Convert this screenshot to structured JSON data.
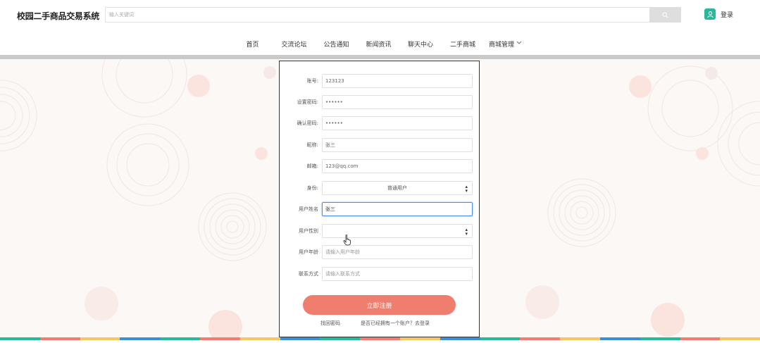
{
  "header": {
    "brand": "校园二手商品交易系统",
    "search_placeholder": "输入关键词",
    "login_label": "登录"
  },
  "nav": {
    "items": [
      {
        "label": "首页",
        "color": "#26b99a"
      },
      {
        "label": "交流论坛",
        "color": "#f07e6e"
      },
      {
        "label": "公告通知",
        "color": "#f5c865"
      },
      {
        "label": "新闻资讯",
        "color": "#3b8ed8"
      },
      {
        "label": "聊天中心",
        "color": "#26b99a"
      },
      {
        "label": "二手商城",
        "color": "#f07e6e"
      },
      {
        "label": "商城管理",
        "color": "#f5c865"
      }
    ]
  },
  "form": {
    "fields": [
      {
        "label": "账号:",
        "value": "123123",
        "placeholder": ""
      },
      {
        "label": "设置密码:",
        "value": "••••••",
        "placeholder": ""
      },
      {
        "label": "确认密码:",
        "value": "••••••",
        "placeholder": ""
      },
      {
        "label": "昵称:",
        "value": "张三",
        "placeholder": ""
      },
      {
        "label": "邮箱:",
        "value": "123@qq.com",
        "placeholder": ""
      },
      {
        "label": "身份:",
        "value": "普通用户",
        "type": "select"
      },
      {
        "label": "用户姓名",
        "value": "张三",
        "placeholder": ""
      },
      {
        "label": "用户性别",
        "value": "",
        "type": "select"
      },
      {
        "label": "用户年龄",
        "value": "",
        "placeholder": "请输入用户年龄"
      },
      {
        "label": "联系方式",
        "value": "",
        "placeholder": "请输入联系方式"
      }
    ],
    "submit_label": "立即注册",
    "back_link": "找回密码",
    "login_link": "是否已经拥有一个账户？去登录"
  },
  "colors": {
    "accent": "#f07e6e",
    "green": "#26b99a",
    "yellow": "#f5c865",
    "blue": "#3b8ed8"
  }
}
